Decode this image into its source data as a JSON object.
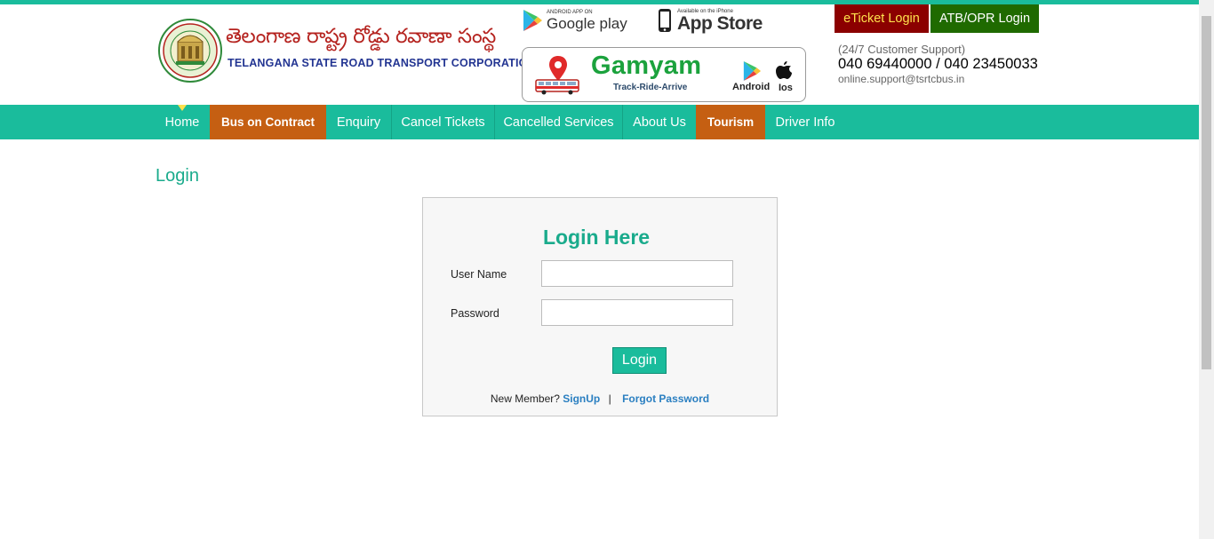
{
  "header": {
    "logo_telugu": "తెలంగాణ రాష్ట్ర రోడ్డు రవాణా సంస్థ",
    "logo_english": "TELANGANA STATE ROAD TRANSPORT CORPORATION",
    "google_play": {
      "small": "ANDROID APP ON",
      "big": "Google play"
    },
    "app_store": {
      "small": "Available on the iPhone",
      "big": "App Store"
    },
    "gamyam": {
      "title": "Gamyam",
      "tagline": "Track-Ride-Arrive",
      "android_label": "Android",
      "ios_label": "Ios"
    },
    "eticket_login": "eTicket Login",
    "atb_login": "ATB/OPR Login",
    "support_label": "(24/7 Customer Support)",
    "support_phones": "040 69440000 / 040 23450033",
    "support_email": "online.support@tsrtcbus.in"
  },
  "nav": {
    "items": [
      {
        "label": "Home"
      },
      {
        "label": "Bus on Contract"
      },
      {
        "label": "Enquiry"
      },
      {
        "label": "Cancel Tickets"
      },
      {
        "label": "Cancelled Services"
      },
      {
        "label": "About Us"
      },
      {
        "label": "Tourism"
      },
      {
        "label": "Driver Info"
      }
    ]
  },
  "main": {
    "page_title": "Login",
    "login_box": {
      "title": "Login Here",
      "username_label": "User Name",
      "username_value": "",
      "password_label": "Password",
      "password_value": "",
      "login_button": "Login",
      "new_member_text": "New Member?",
      "signup_link": "SignUp",
      "separator": "|",
      "forgot_link": "Forgot Password"
    }
  },
  "colors": {
    "accent": "#1abc9c",
    "nav_orange": "#c55f12",
    "eticket_bg": "#8b0000",
    "eticket_text": "#ffe14d",
    "atb_bg": "#1f6a00",
    "link": "#2a7fc1"
  }
}
